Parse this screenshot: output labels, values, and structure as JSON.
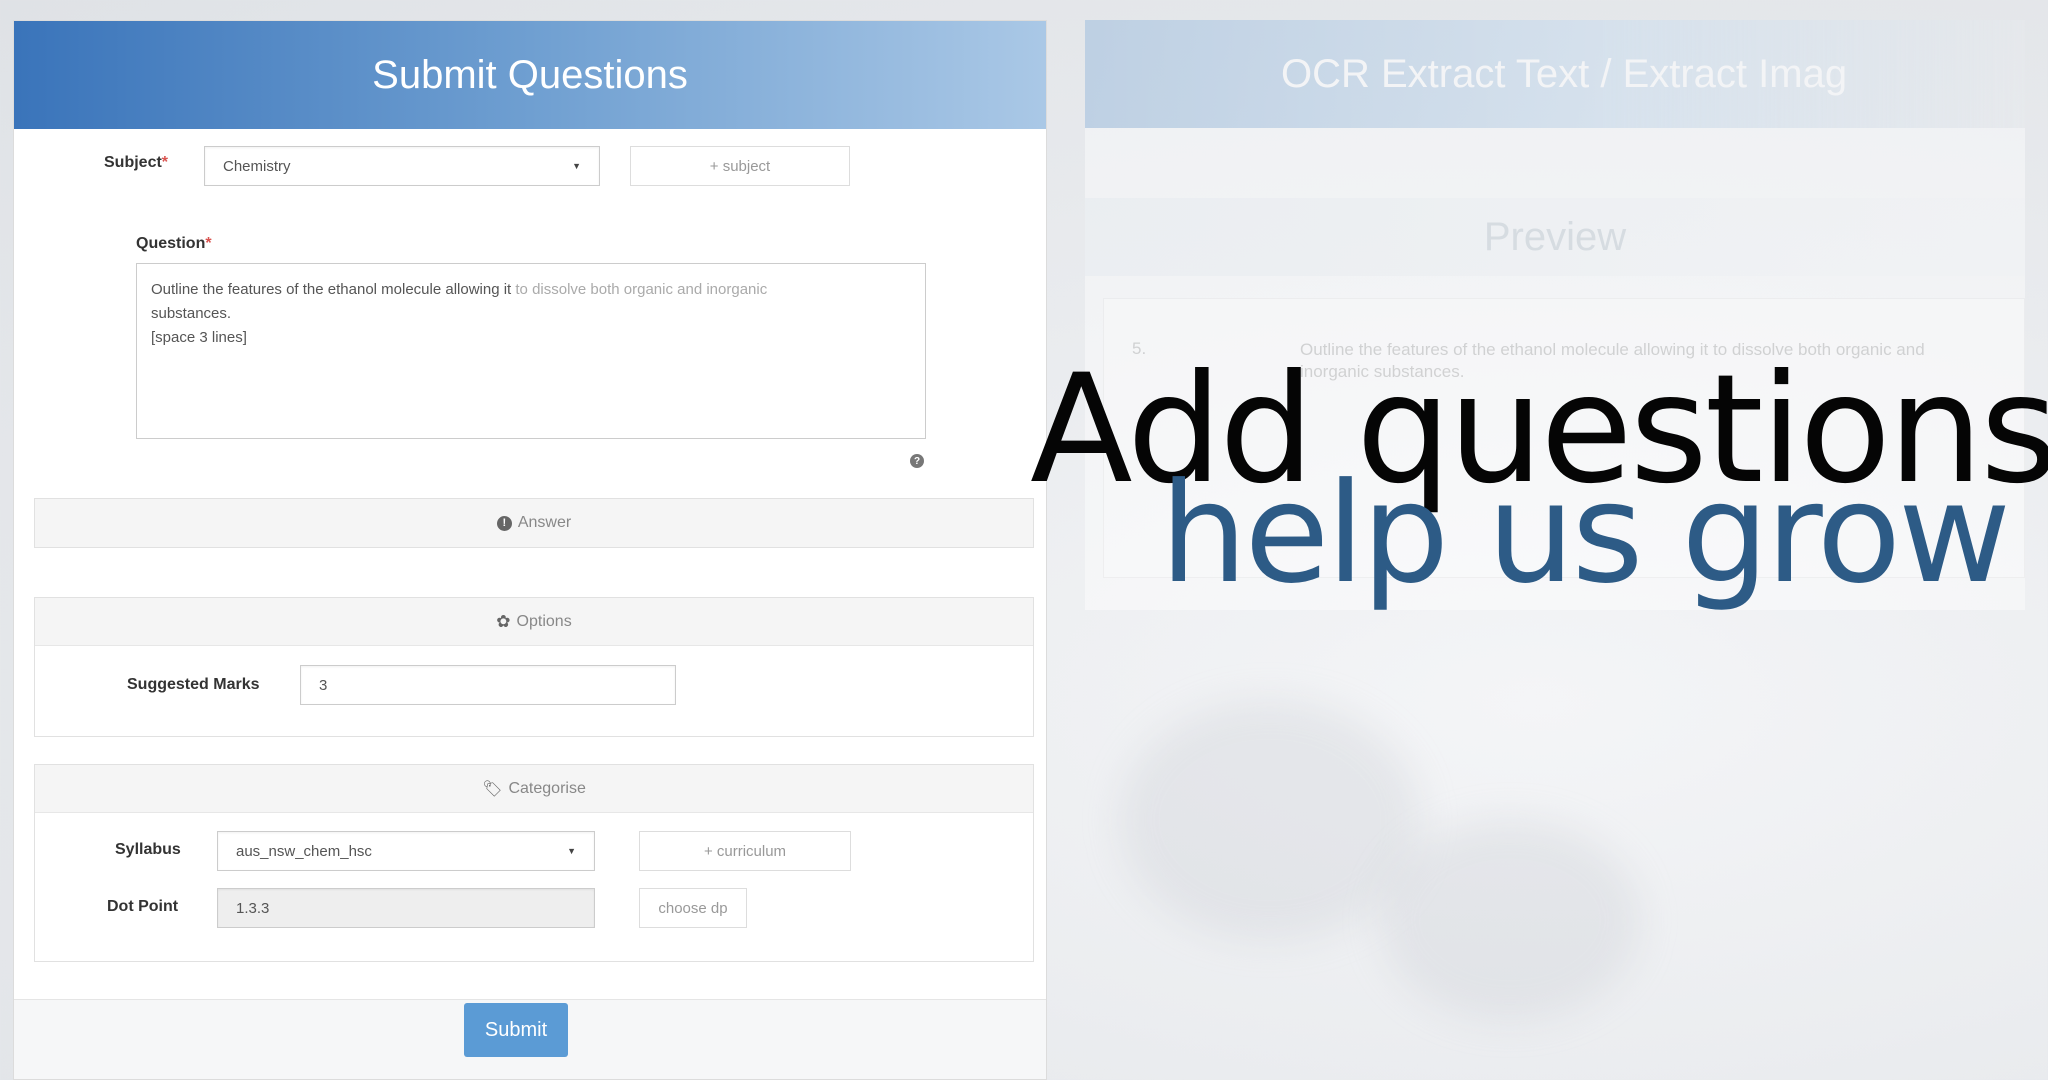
{
  "left_panel": {
    "title": "Submit Questions",
    "subject": {
      "label": "Subject",
      "required_mark": "*",
      "value": "Chemistry",
      "add_button": "+ subject"
    },
    "question": {
      "label": "Question",
      "required_mark": "*",
      "line1_a": "Outline the features of the ethanol molecule allowing it ",
      "line1_b": "to dissolve both organic and inorganic",
      "line2": "substances.",
      "line3": "[space 3 lines]"
    },
    "answer_section": {
      "title": "Answer"
    },
    "options_section": {
      "title": "Options",
      "suggested_marks_label": "Suggested Marks",
      "suggested_marks_value": "3"
    },
    "categorise_section": {
      "title": "Categorise",
      "syllabus_label": "Syllabus",
      "syllabus_value": "aus_nsw_chem_hsc",
      "add_curriculum": "+ curriculum",
      "dot_point_label": "Dot Point",
      "dot_point_value": "1.3.3",
      "choose_dp": "choose dp"
    },
    "submit_label": "Submit"
  },
  "right_panel": {
    "title": "OCR Extract Text / Extract Imag",
    "preview_title": "Preview",
    "question_number": "5.",
    "question_text": "Outline the features of the ethanol molecule allowing it to dissolve both organic and inorganic substances."
  },
  "overlay": {
    "line1": "Add questions",
    "line2": "help us grow"
  },
  "colors": {
    "header_blue": "#3a74ba",
    "submit_blue": "#5b9bd5",
    "overlay_blue": "#2d5b86",
    "required_red": "#d9534f"
  }
}
